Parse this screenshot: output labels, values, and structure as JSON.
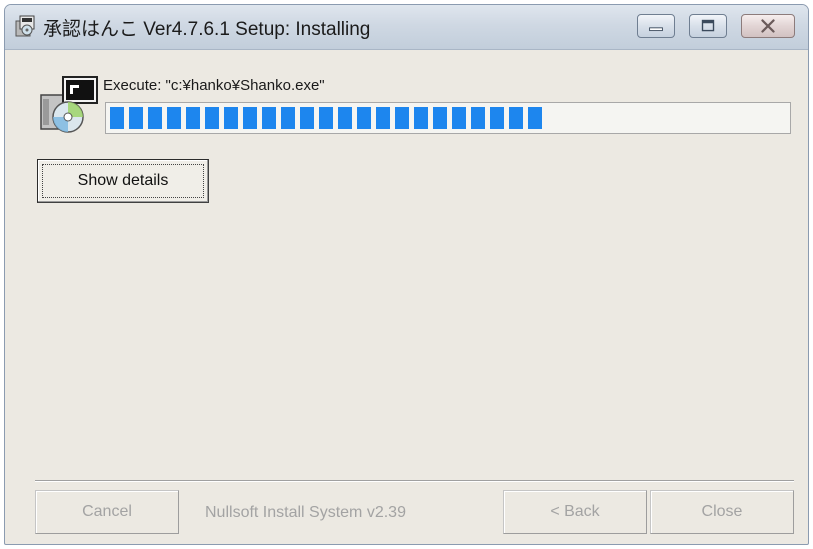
{
  "window": {
    "title": "承認はんこ Ver4.7.6.1 Setup: Installing"
  },
  "titlebar_buttons": {
    "minimize_icon": "minimize-icon",
    "maximize_icon": "maximize-icon",
    "close_icon": "close-icon"
  },
  "install": {
    "status": "Execute: \"c:¥hanko¥Shanko.exe\"",
    "progress_fraction": 0.64,
    "accent_color": "#1d86ee",
    "show_details_label": "Show details"
  },
  "footer": {
    "branding": "Nullsoft Install System v2.39",
    "cancel_label": "Cancel",
    "back_label": "< Back",
    "close_label": "Close"
  }
}
